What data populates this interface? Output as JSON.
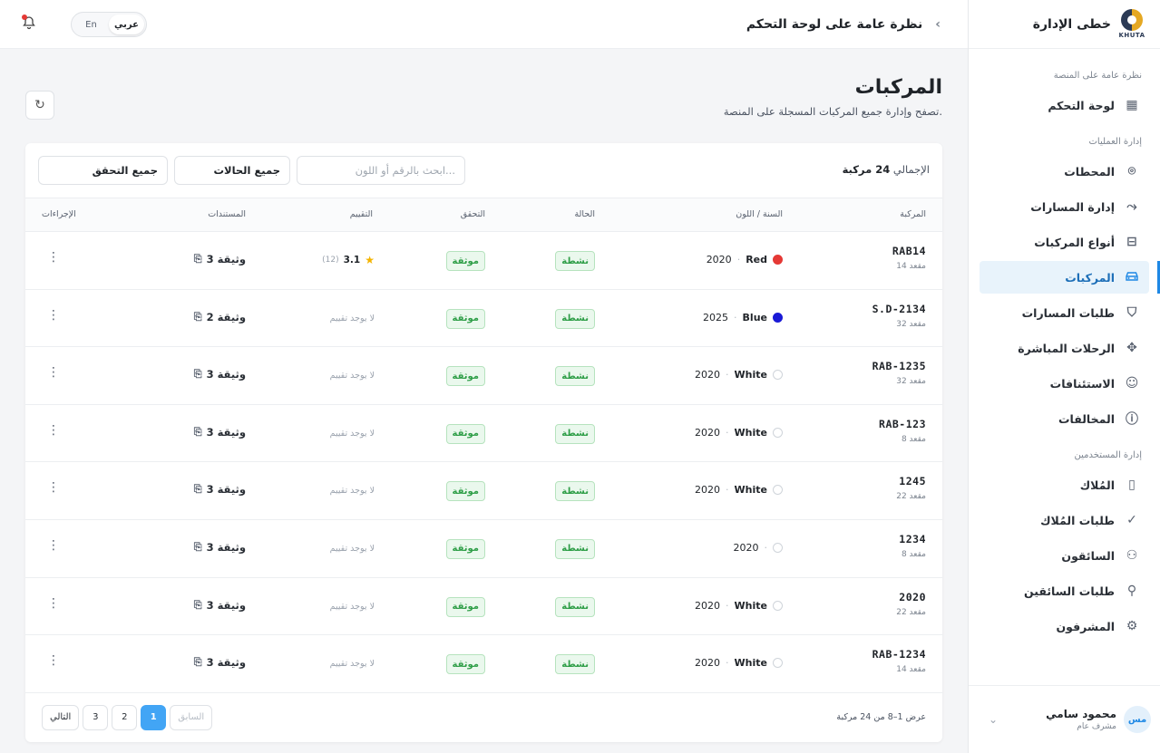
{
  "brand": {
    "name": "خطى الإدارة",
    "logo_text": "KHUTA"
  },
  "topbar": {
    "breadcrumb": "نظرة عامة على لوحة التحكم",
    "lang_en": "En",
    "lang_ar": "عربي"
  },
  "sidebar": {
    "section1": "نظرة عامة على المنصة",
    "dashboard": "لوحة التحكم",
    "section2": "إدارة العمليات",
    "stations": "المحطات",
    "routes": "إدارة المسارات",
    "vehicle_types": "أنواع المركبات",
    "vehicles": "المركبات",
    "route_requests": "طلبات المسارات",
    "live_trips": "الرحلات المباشرة",
    "appeals": "الاستئنافات",
    "violations": "المخالفات",
    "section3": "إدارة المستخدمين",
    "owners": "المُلاك",
    "owner_requests": "طلبات المُلاك",
    "drivers": "السائقون",
    "driver_requests": "طلبات السائقين",
    "supervisors": "المشرفون"
  },
  "user": {
    "name": "محمود سامي",
    "role": "مشرف عام",
    "initials": "مس"
  },
  "page": {
    "title": "المركبات",
    "subtitle": "تصفح وإدارة جميع المركبات المسجلة على المنصة."
  },
  "filters": {
    "total_label": "الإجمالي",
    "total_value": "24 مركبة",
    "search_placeholder": "ابحث بالرقم أو اللون...",
    "status": "جميع الحالات",
    "verification": "جميع التحقق"
  },
  "table": {
    "headers": {
      "vehicle": "المركبة",
      "year_color": "السنة / اللون",
      "status": "الحالة",
      "verification": "التحقق",
      "rating": "التقييم",
      "documents": "المستندات",
      "actions": "الإجراءات"
    },
    "rows": [
      {
        "plate": "RAB14",
        "seats": "14 مقعد",
        "year": "2020",
        "color": "Red",
        "color_hex": "#e53935",
        "status": "نشطة",
        "verified": "موثقة",
        "rating": "3.1",
        "rating_count": "(12)",
        "no_rating": "",
        "docs": "3 وثيقة"
      },
      {
        "plate": "S.D-2134",
        "seats": "32 مقعد",
        "year": "2025",
        "color": "Blue",
        "color_hex": "#1a1ad6",
        "status": "نشطة",
        "verified": "موثقة",
        "rating": "",
        "rating_count": "",
        "no_rating": "لا يوجد تقييم",
        "docs": "2 وثيقة"
      },
      {
        "plate": "RAB-1235",
        "seats": "32 مقعد",
        "year": "2020",
        "color": "White",
        "color_hex": "#ffffff",
        "status": "نشطة",
        "verified": "موثقة",
        "rating": "",
        "rating_count": "",
        "no_rating": "لا يوجد تقييم",
        "docs": "3 وثيقة"
      },
      {
        "plate": "RAB-123",
        "seats": "8 مقعد",
        "year": "2020",
        "color": "White",
        "color_hex": "#ffffff",
        "status": "نشطة",
        "verified": "موثقة",
        "rating": "",
        "rating_count": "",
        "no_rating": "لا يوجد تقييم",
        "docs": "3 وثيقة"
      },
      {
        "plate": "1245",
        "seats": "22 مقعد",
        "year": "2020",
        "color": "White",
        "color_hex": "#ffffff",
        "status": "نشطة",
        "verified": "موثقة",
        "rating": "",
        "rating_count": "",
        "no_rating": "لا يوجد تقييم",
        "docs": "3 وثيقة"
      },
      {
        "plate": "1234",
        "seats": "8 مقعد",
        "year": "2020",
        "color": "",
        "color_hex": "#ffffff",
        "status": "نشطة",
        "verified": "موثقة",
        "rating": "",
        "rating_count": "",
        "no_rating": "لا يوجد تقييم",
        "docs": "3 وثيقة"
      },
      {
        "plate": "2020",
        "seats": "22 مقعد",
        "year": "2020",
        "color": "White",
        "color_hex": "#ffffff",
        "status": "نشطة",
        "verified": "موثقة",
        "rating": "",
        "rating_count": "",
        "no_rating": "لا يوجد تقييم",
        "docs": "3 وثيقة"
      },
      {
        "plate": "RAB-1234",
        "seats": "14 مقعد",
        "year": "2020",
        "color": "White",
        "color_hex": "#ffffff",
        "status": "نشطة",
        "verified": "موثقة",
        "rating": "",
        "rating_count": "",
        "no_rating": "لا يوجد تقييم",
        "docs": "3 وثيقة"
      }
    ]
  },
  "pagination": {
    "showing": "عرض 1–8 من 24 مركبة",
    "prev": "السابق",
    "next": "التالي",
    "pages": [
      "1",
      "2",
      "3"
    ],
    "current": "1"
  }
}
